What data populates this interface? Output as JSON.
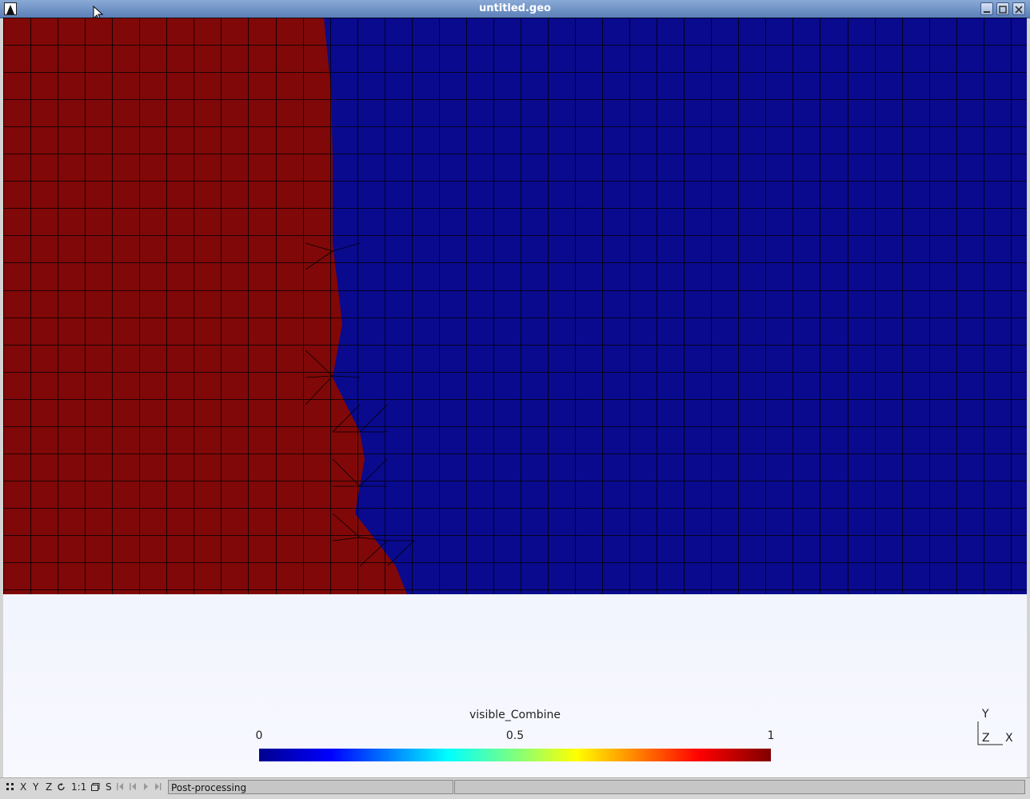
{
  "window": {
    "title": "untitled.geo"
  },
  "colorbar": {
    "title": "visible_Combine",
    "ticks": [
      "0",
      "0.5",
      "1"
    ]
  },
  "axes": {
    "y": "Y",
    "z": "Z",
    "x": "X"
  },
  "statusbar": {
    "buttons": [
      "X",
      "Y",
      "Z",
      "1:1",
      "S"
    ],
    "message": "Post-processing"
  },
  "colors": {
    "region_red": "#800808",
    "region_blue": "#0a0a8e",
    "mesh_line": "#000000"
  }
}
